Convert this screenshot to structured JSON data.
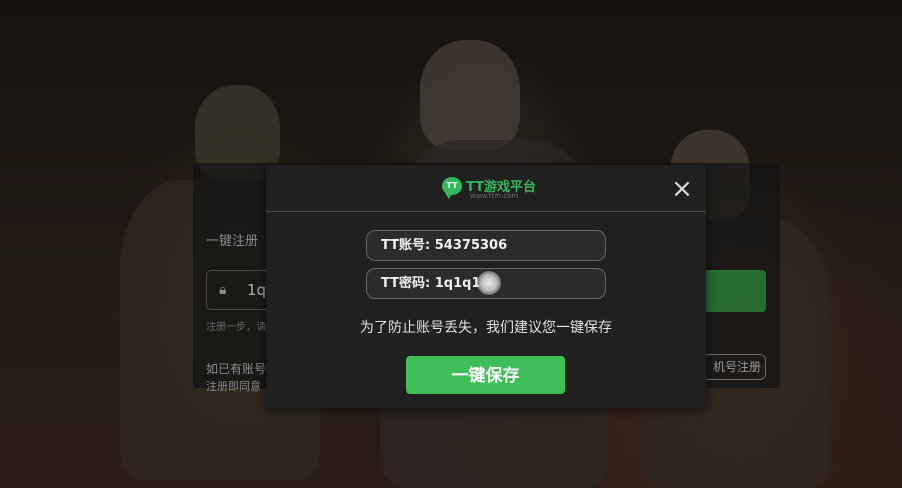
{
  "background_panel": {
    "title_partial": "一键注册",
    "password_value_partial": "1q",
    "hint_partial": "注册一步，请",
    "login_prompt_partial": "如已有账号",
    "agreement_partial": "注册即同意",
    "alt_register_partial": "机号注册"
  },
  "modal": {
    "logo_icon": "TT",
    "logo_title": "TT游戏平台",
    "logo_url": "www.ttm.com",
    "close_icon": "×",
    "account_label": "TT账号: 54375306",
    "password_label": "TT密码: 1q1q1q",
    "hint": "为了防止账号丢失，我们建议您一键保存",
    "save_button": "一键保存"
  },
  "colors": {
    "accent_green": "#3dbe57",
    "modal_bg": "#202020"
  }
}
